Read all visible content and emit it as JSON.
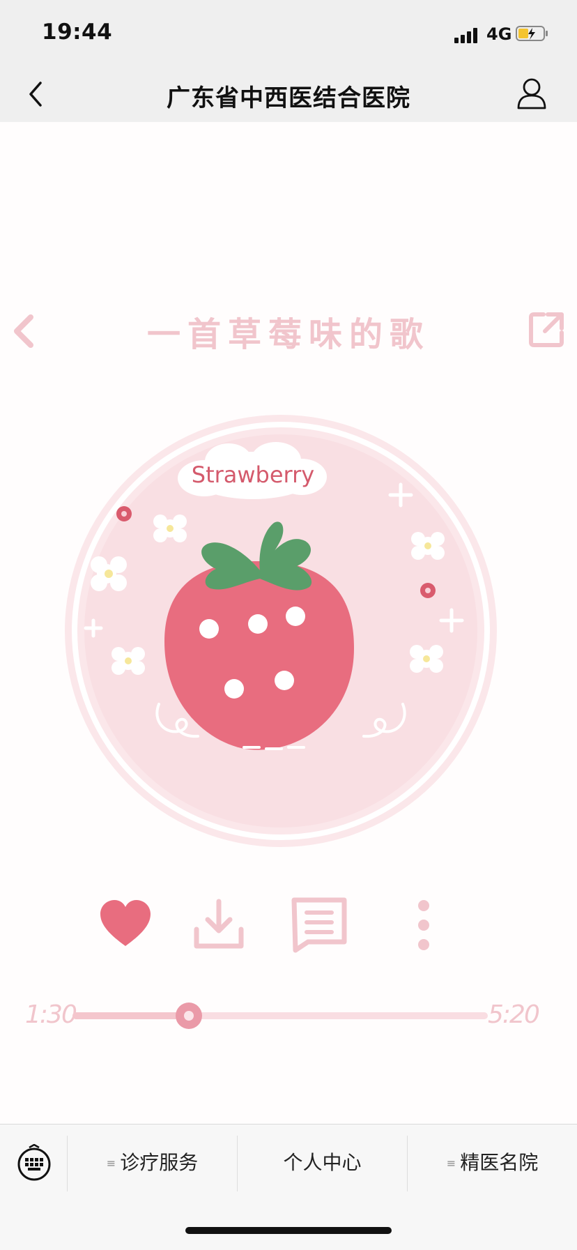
{
  "status_bar": {
    "time": "19:44",
    "network": "4G"
  },
  "nav": {
    "title": "广东省中西医结合医院"
  },
  "artwork": {
    "song_title": "一首草莓味的歌",
    "cloud_label": "Strawberry",
    "progress": {
      "current": "1:30",
      "total": "5:20",
      "fraction": 0.28
    }
  },
  "bottom_menu": {
    "items": [
      {
        "label": "诊疗服务",
        "has_submenu": true
      },
      {
        "label": "个人中心",
        "has_submenu": false
      },
      {
        "label": "精医名院",
        "has_submenu": true
      }
    ],
    "submenu_mark": "≡"
  },
  "colors": {
    "accent_pink": "#e86d7f",
    "soft_pink": "#f1c5cc",
    "leaf_green": "#5a9e6a"
  }
}
